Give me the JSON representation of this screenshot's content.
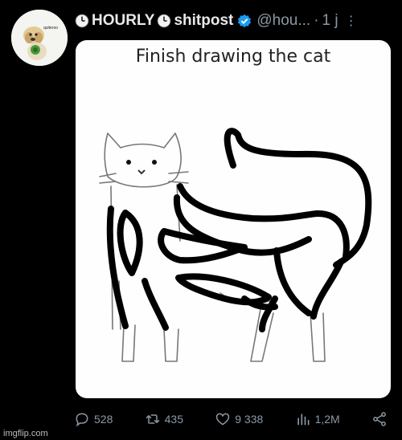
{
  "post": {
    "display_name": "HOURLY shitpost",
    "display_name_parts": [
      "HOURLY",
      "shitpost"
    ],
    "handle": "@hou...",
    "separator": "·",
    "time": "1 j",
    "avatar_text": "quiteroo"
  },
  "media": {
    "caption": "Finish drawing the cat"
  },
  "actions": {
    "replies": "528",
    "reposts": "435",
    "likes": "9 338",
    "views": "1,2M"
  },
  "watermark": "imgflip.com",
  "colors": {
    "background": "#000000",
    "verified": "#1d9bf0",
    "muted": "#8b98a5"
  },
  "icons": [
    "clock-icon",
    "verified-badge-icon",
    "more-icon",
    "reply-icon",
    "repost-icon",
    "like-icon",
    "views-icon",
    "share-icon"
  ]
}
